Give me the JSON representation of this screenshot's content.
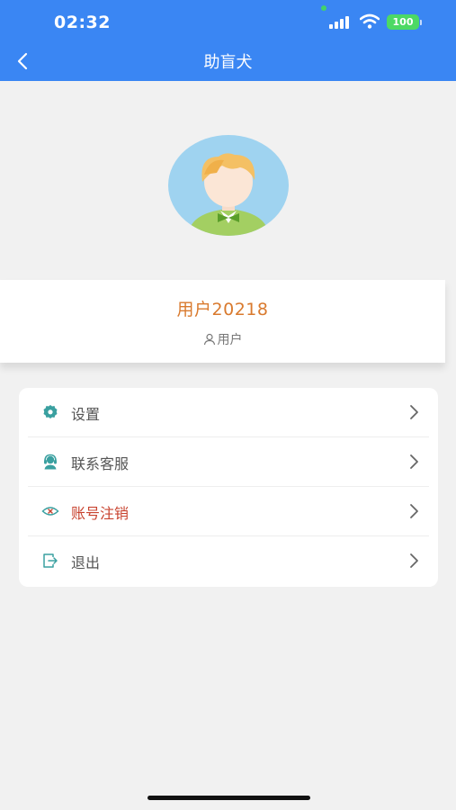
{
  "status_bar": {
    "time": "02:32",
    "battery": "100",
    "icons": [
      "signal-icon",
      "wifi-icon",
      "battery-icon"
    ]
  },
  "nav": {
    "title": "助盲犬",
    "back_icon": "chevron-left-icon"
  },
  "profile": {
    "avatar": "avatar-illustration",
    "username": "用户20218",
    "role": "用户",
    "role_icon": "person-icon"
  },
  "menu": {
    "items": [
      {
        "label": "设置",
        "icon": "gear-icon"
      },
      {
        "label": "联系客服",
        "icon": "headset-icon"
      },
      {
        "label": "账号注销",
        "icon": "cancel-account-icon",
        "color": "#c8432f"
      },
      {
        "label": "退出",
        "icon": "logout-icon"
      }
    ]
  },
  "colors": {
    "header": "#3a86f3",
    "username": "#d97a2e",
    "icon_accent": "#3aa0a0",
    "danger": "#c8432f",
    "background": "#f1f1f1"
  }
}
